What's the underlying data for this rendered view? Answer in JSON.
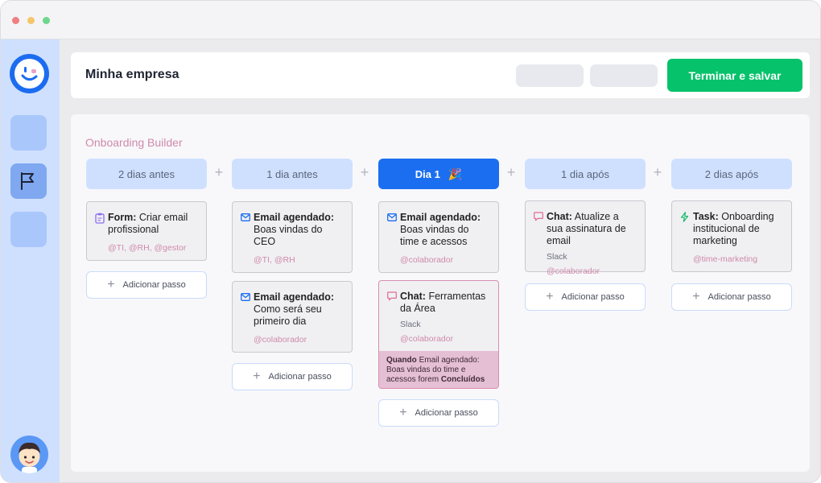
{
  "header": {
    "company_name": "Minha empresa",
    "save_label": "Terminar e salvar"
  },
  "board": {
    "title": "Onboarding Builder"
  },
  "add_step_label": "Adicionar passo",
  "columns": [
    {
      "label": "2 dias antes",
      "cards": [
        {
          "type": "Form:",
          "text": "Criar email profissional",
          "tags": "@TI, @RH, @gestor"
        }
      ]
    },
    {
      "label": "1 dia antes",
      "cards": [
        {
          "type": "Email agendado:",
          "text": "Boas vindas do CEO",
          "tags": "@TI, @RH"
        },
        {
          "type": "Email agendado:",
          "text": "Como será seu primeiro dia",
          "tags": "@colaborador"
        }
      ]
    },
    {
      "label": "Dia 1",
      "emoji": "🎉",
      "cards": [
        {
          "type": "Email agendado:",
          "text": "Boas vindas do time e acessos",
          "tags": "@colaborador"
        },
        {
          "type": "Chat:",
          "text": "Ferramentas da Área",
          "sub": "Slack",
          "tags": "@colaborador",
          "condition": {
            "when": "Quando",
            "text": "Email agendado: Boas vindas do time e acessos forem",
            "state": "Concluídos"
          }
        }
      ]
    },
    {
      "label": "1 dia após",
      "cards": [
        {
          "type": "Chat:",
          "text": "Atualize a sua assinatura de email",
          "sub": "Slack",
          "tags": "@colaborador"
        }
      ]
    },
    {
      "label": "2 dias após",
      "cards": [
        {
          "type": "Task:",
          "text": "Onboarding institucional de marketing",
          "tags": "@time-marketing"
        }
      ]
    }
  ],
  "icons": {
    "form": "clipboard-icon",
    "email": "envelope-icon",
    "chat": "chat-bubble-icon",
    "task": "lightning-icon"
  },
  "colors": {
    "accent": "#1b6ef0",
    "save": "#06c26b",
    "tag": "#cf8aa9",
    "sidebar": "#cfe0ff"
  }
}
